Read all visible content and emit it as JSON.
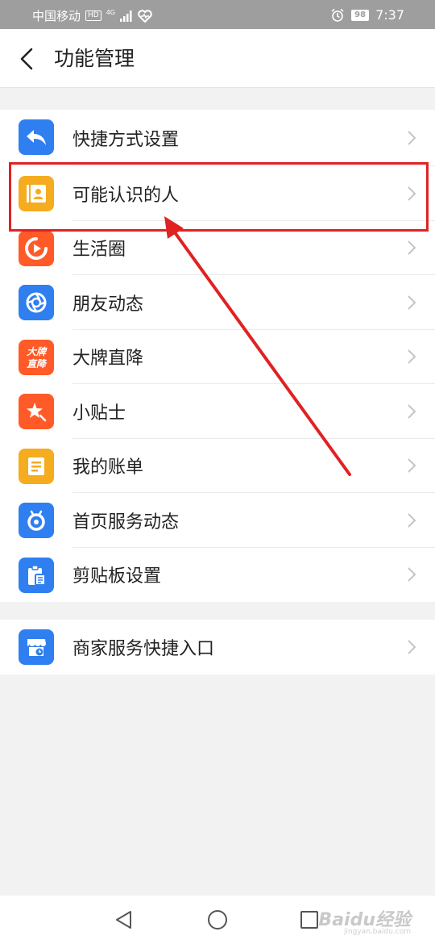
{
  "status_bar": {
    "carrier": "中国移动",
    "hd": "HD",
    "network": "4G",
    "battery": "98",
    "time": "7:37"
  },
  "header": {
    "title": "功能管理"
  },
  "group1": {
    "items": [
      {
        "label": "快捷方式设置",
        "icon": "reply-shortcut-icon",
        "color": "#2f7ff0"
      },
      {
        "label": "可能认识的人",
        "icon": "contact-card-icon",
        "color": "#f5ac1e"
      },
      {
        "label": "生活圈",
        "icon": "life-circle-icon",
        "color": "#ff5a27"
      },
      {
        "label": "朋友动态",
        "icon": "aperture-icon",
        "color": "#2f7ff0"
      },
      {
        "label": "大牌直降",
        "icon": "brand-sale-icon",
        "color": "#ff5a27",
        "icon_text": "大牌\n直降"
      },
      {
        "label": "小贴士",
        "icon": "star-tip-icon",
        "color": "#ff5a27"
      },
      {
        "label": "我的账单",
        "icon": "bill-icon",
        "color": "#f5ac1e"
      },
      {
        "label": "首页服务动态",
        "icon": "service-feed-icon",
        "color": "#2f7ff0"
      },
      {
        "label": "剪贴板设置",
        "icon": "clipboard-icon",
        "color": "#2f7ff0"
      }
    ]
  },
  "group2": {
    "items": [
      {
        "label": "商家服务快捷入口",
        "icon": "merchant-store-icon",
        "color": "#2f7ff0"
      }
    ]
  },
  "annotation": {
    "color": "#e02222"
  },
  "watermark": {
    "text": "Baidu经验",
    "sub": "jingyan.baidu.com"
  }
}
